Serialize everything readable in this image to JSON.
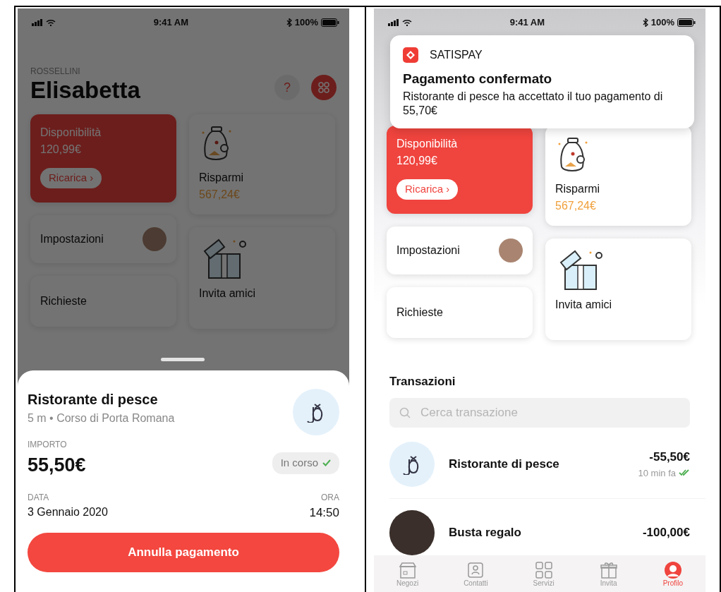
{
  "screens": [
    {
      "kind": "detail",
      "status_bar": {
        "time": "9:41 AM",
        "battery": "100%"
      },
      "header": {
        "surname": "ROSSELLINI",
        "name": "Elisabetta",
        "help": "?"
      },
      "tiles": {
        "balance": {
          "label": "Disponibilità",
          "amount": "120,99€",
          "button": "Ricarica ›"
        },
        "savings": {
          "label": "Risparmi",
          "amount": "567,24€"
        },
        "settings": "Impostazioni",
        "requests": "Richieste",
        "invite": "Invita amici"
      },
      "sheet": {
        "title": "Ristorante di pesce",
        "subtitle": "5 m • Corso di Porta Romana",
        "amount_label": "IMPORTO",
        "amount": "55,50€",
        "status": "In corso",
        "date_label": "DATA",
        "date": "3 Gennaio 2020",
        "time_label": "ORA",
        "time": "14:50",
        "cancel_button": "Annulla pagamento"
      }
    },
    {
      "kind": "notified",
      "status_bar": {
        "time": "9:41 AM",
        "battery": "100%"
      },
      "notification": {
        "app": "SATISPAY",
        "title": "Pagamento confermato",
        "body": "Ristorante di pesce ha accettato il tuo pagamento di 55,70€"
      },
      "tiles": {
        "balance": {
          "label": "Disponibilità",
          "amount": "120,99€",
          "button": "Ricarica ›"
        },
        "savings": {
          "label": "Risparmi",
          "amount": "567,24€"
        },
        "settings": "Impostazioni",
        "requests": "Richieste",
        "invite": "Invita amici"
      },
      "transactions": {
        "title": "Transazioni",
        "search_placeholder": "Cerca transazione",
        "rows": [
          {
            "kind": "shop",
            "name": "Ristorante di pesce",
            "amount": "-55,50€",
            "time": "10 min fa",
            "confirmed": true
          },
          {
            "kind": "person",
            "name": "Busta regalo",
            "amount": "-100,00€"
          }
        ]
      },
      "tab_bar": [
        {
          "kind": "shop",
          "label": "Negozi",
          "selected": false
        },
        {
          "kind": "contacts",
          "label": "Contatti",
          "selected": false
        },
        {
          "kind": "services",
          "label": "Servizi",
          "selected": false
        },
        {
          "kind": "gift",
          "label": "Invita",
          "selected": false
        },
        {
          "kind": "profile",
          "label": "Profilo",
          "selected": true
        }
      ]
    }
  ]
}
